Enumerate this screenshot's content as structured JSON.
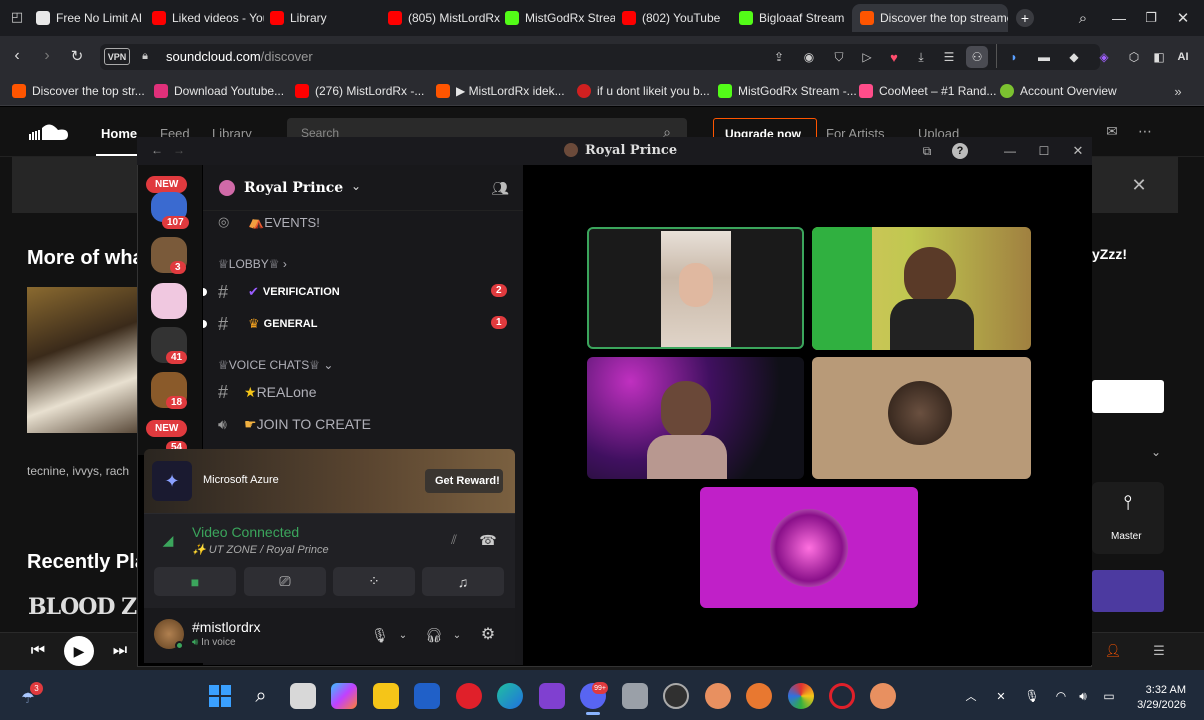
{
  "browser": {
    "tabs": [
      {
        "label": "Free No Limit AI I",
        "icon": "ai-icon"
      },
      {
        "label": "Liked videos - You",
        "icon": "youtube-icon"
      },
      {
        "label": "Library",
        "icon": "youtube-icon"
      },
      {
        "label": "(805) MistLordRx",
        "icon": "youtube-icon"
      },
      {
        "label": "MistGodRx Stream",
        "icon": "kick-icon"
      },
      {
        "label": "(802) YouTube",
        "icon": "youtube-icon"
      },
      {
        "label": "Bigloaaf Stream",
        "icon": "kick-icon"
      },
      {
        "label": "Discover the top streamed",
        "icon": "soundcloud-icon"
      }
    ],
    "vpn_label": "VPN",
    "url_host": "soundcloud.com",
    "url_path": "/discover",
    "ai_label": "AI",
    "bookmarks": [
      "Discover the top str...",
      "Download Youtube...",
      "(276) MistLordRx -...",
      "▶ MistLordRx idek...",
      "if u dont likeit you b...",
      "MistGodRx Stream -...",
      "CooMeet – #1 Rand...",
      "Account Overview"
    ]
  },
  "soundcloud": {
    "nav": {
      "home": "Home",
      "feed": "Feed",
      "library": "Library",
      "search_placeholder": "Search",
      "upgrade": "Upgrade now",
      "for_artists": "For Artists",
      "upload": "Upload"
    },
    "more_of_what": "More of wha",
    "artists_line": "tecnine, ivvys, rach",
    "recently_played": "Recently Pla",
    "right_heading": "yZzz!",
    "master_label": "Master",
    "blood_text": "BLOOD ZON"
  },
  "discord": {
    "window_title": "Royal Prince",
    "server_name": "Royal Prince",
    "new_badge": "NEW",
    "server_badges": [
      "107",
      "3",
      "41",
      "18",
      "54"
    ],
    "channels": {
      "events": "EVENTS!",
      "lobby_category": "LOBBY",
      "verification": "VERIFICATION",
      "verification_badge": "2",
      "general": "GENERAL",
      "general_badge": "1",
      "voice_category": "VOICE CHATS",
      "realone": "REALone",
      "join_to_create": "JOIN TO CREATE"
    },
    "promo": {
      "title": "Microsoft Azure",
      "button": "Get Reward!"
    },
    "voice": {
      "status": "Video Connected",
      "location": "UT ZONE / Royal Prince"
    },
    "user": {
      "name": "#mistlordrx",
      "status": "In voice"
    }
  },
  "taskbar": {
    "notification_count": "3",
    "time": "3:32 AM",
    "date": "3/29/2026",
    "app_badge": "99+"
  },
  "colors": {
    "accent_green": "#3ba55c",
    "badge_red": "#e03a3e",
    "tile_magenta": "#c020c8",
    "tile_tan": "#b89a78",
    "soundcloud_orange": "#ff5500"
  }
}
